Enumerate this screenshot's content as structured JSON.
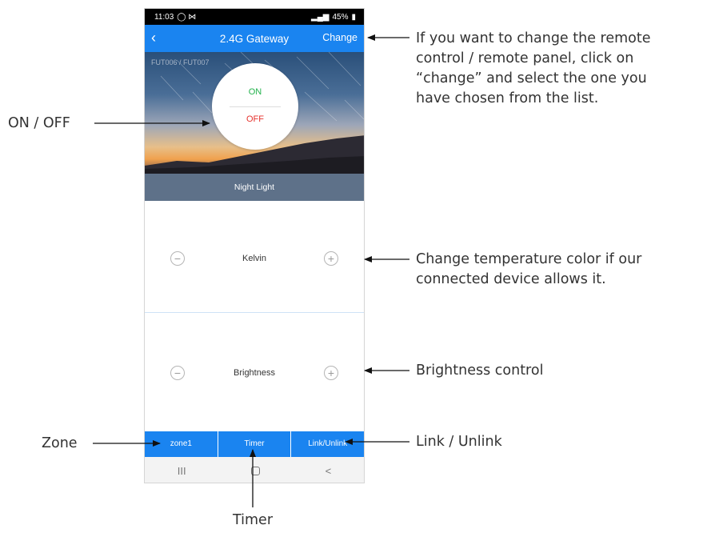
{
  "status_bar": {
    "time": "11:03",
    "icons_left": "◯ ⋈",
    "battery": "45%"
  },
  "app_bar": {
    "back_icon": "‹",
    "title": "2.4G Gateway",
    "change_label": "Change"
  },
  "hero": {
    "remote_name": "FUT006 / FUT007",
    "on_label": "ON",
    "off_label": "OFF"
  },
  "mode": {
    "label": "Night Light"
  },
  "controls": {
    "kelvin": {
      "label": "Kelvin",
      "minus": "−",
      "plus": "+"
    },
    "brightness": {
      "label": "Brightness",
      "minus": "−",
      "plus": "+"
    }
  },
  "bottom_tabs": [
    "zone1",
    "Timer",
    "Link/Unlink"
  ],
  "nav": {
    "recents": "III",
    "back": "<"
  },
  "annotations": {
    "change_1": "If you want to change the remote",
    "change_2": "control / remote panel, click on",
    "change_3": "“change” and select the one you",
    "change_4": "have chosen from the list.",
    "onoff": "ON / OFF",
    "kelvin_1": "Change temperature color if our",
    "kelvin_2": "connected device allows it.",
    "brightness": "Brightness control",
    "zone": "Zone",
    "link": "Link / Unlink",
    "timer": "Timer"
  },
  "colors": {
    "accent": "#1a84f0",
    "mode_bar": "#5e7189",
    "on": "#22b24c",
    "off": "#e6322d"
  }
}
